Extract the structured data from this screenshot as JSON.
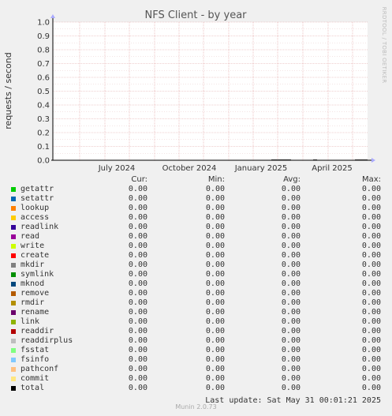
{
  "chart_data": {
    "type": "line",
    "title": "NFS Client - by year",
    "ylabel": "requests / second",
    "side_text": "RRDTOOL / TOBI OETIKER",
    "ylim": [
      0,
      1.0
    ],
    "yticks": [
      "0.0",
      "0.1",
      "0.2",
      "0.3",
      "0.4",
      "0.5",
      "0.6",
      "0.7",
      "0.8",
      "0.9",
      "1.0"
    ],
    "xticks": [
      "July 2024",
      "October 2024",
      "January 2025",
      "April 2025"
    ],
    "grid": true,
    "series": [
      {
        "name": "getattr",
        "color": "#00cc00",
        "cur": "0.00",
        "min": "0.00",
        "avg": "0.00",
        "max": "0.00"
      },
      {
        "name": "setattr",
        "color": "#0066b3",
        "cur": "0.00",
        "min": "0.00",
        "avg": "0.00",
        "max": "0.00"
      },
      {
        "name": "lookup",
        "color": "#ff8000",
        "cur": "0.00",
        "min": "0.00",
        "avg": "0.00",
        "max": "0.00"
      },
      {
        "name": "access",
        "color": "#ffcc00",
        "cur": "0.00",
        "min": "0.00",
        "avg": "0.00",
        "max": "0.00"
      },
      {
        "name": "readlink",
        "color": "#330099",
        "cur": "0.00",
        "min": "0.00",
        "avg": "0.00",
        "max": "0.00"
      },
      {
        "name": "read",
        "color": "#990099",
        "cur": "0.00",
        "min": "0.00",
        "avg": "0.00",
        "max": "0.00"
      },
      {
        "name": "write",
        "color": "#ccff00",
        "cur": "0.00",
        "min": "0.00",
        "avg": "0.00",
        "max": "0.00"
      },
      {
        "name": "create",
        "color": "#ff0000",
        "cur": "0.00",
        "min": "0.00",
        "avg": "0.00",
        "max": "0.00"
      },
      {
        "name": "mkdir",
        "color": "#808080",
        "cur": "0.00",
        "min": "0.00",
        "avg": "0.00",
        "max": "0.00"
      },
      {
        "name": "symlink",
        "color": "#008f00",
        "cur": "0.00",
        "min": "0.00",
        "avg": "0.00",
        "max": "0.00"
      },
      {
        "name": "mknod",
        "color": "#00487d",
        "cur": "0.00",
        "min": "0.00",
        "avg": "0.00",
        "max": "0.00"
      },
      {
        "name": "remove",
        "color": "#b35a00",
        "cur": "0.00",
        "min": "0.00",
        "avg": "0.00",
        "max": "0.00"
      },
      {
        "name": "rmdir",
        "color": "#b38f00",
        "cur": "0.00",
        "min": "0.00",
        "avg": "0.00",
        "max": "0.00"
      },
      {
        "name": "rename",
        "color": "#6b006b",
        "cur": "0.00",
        "min": "0.00",
        "avg": "0.00",
        "max": "0.00"
      },
      {
        "name": "link",
        "color": "#8fb300",
        "cur": "0.00",
        "min": "0.00",
        "avg": "0.00",
        "max": "0.00"
      },
      {
        "name": "readdir",
        "color": "#b30000",
        "cur": "0.00",
        "min": "0.00",
        "avg": "0.00",
        "max": "0.00"
      },
      {
        "name": "readdirplus",
        "color": "#bebebe",
        "cur": "0.00",
        "min": "0.00",
        "avg": "0.00",
        "max": "0.00"
      },
      {
        "name": "fsstat",
        "color": "#80ff80",
        "cur": "0.00",
        "min": "0.00",
        "avg": "0.00",
        "max": "0.00"
      },
      {
        "name": "fsinfo",
        "color": "#80c9ff",
        "cur": "0.00",
        "min": "0.00",
        "avg": "0.00",
        "max": "0.00"
      },
      {
        "name": "pathconf",
        "color": "#ffc080",
        "cur": "0.00",
        "min": "0.00",
        "avg": "0.00",
        "max": "0.00"
      },
      {
        "name": "commit",
        "color": "#ffe680",
        "cur": "0.00",
        "min": "0.00",
        "avg": "0.00",
        "max": "0.00"
      },
      {
        "name": "total",
        "color": "#000000",
        "cur": "0.00",
        "min": "0.00",
        "avg": "0.00",
        "max": "0.00"
      }
    ]
  },
  "legend_headers": {
    "cur": "Cur:",
    "min": "Min:",
    "avg": "Avg:",
    "max": "Max:"
  },
  "footer": {
    "last_update": "Last update: Sat May 31 00:01:21 2025",
    "version": "Munin 2.0.73"
  }
}
